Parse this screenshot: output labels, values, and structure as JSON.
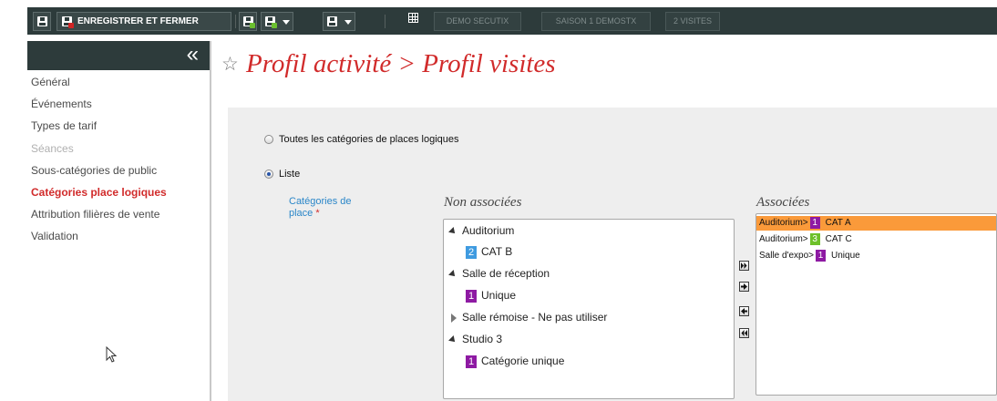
{
  "toolbar": {
    "save_and_close_label": "ENREGISTRER ET FERMER",
    "info_tags": [
      "DEMO SECUTIX",
      "SAISON 1 DEMOSTX",
      "2 VISITES"
    ]
  },
  "sidebar": {
    "items": [
      {
        "label": "Général",
        "state": "normal"
      },
      {
        "label": "Événements",
        "state": "normal"
      },
      {
        "label": "Types de tarif",
        "state": "normal"
      },
      {
        "label": "Séances",
        "state": "disabled"
      },
      {
        "label": "Sous-catégories de public",
        "state": "normal"
      },
      {
        "label": "Catégories place logiques",
        "state": "active"
      },
      {
        "label": "Attribution filières de vente",
        "state": "normal"
      },
      {
        "label": "Validation",
        "state": "normal"
      }
    ]
  },
  "page": {
    "title": "Profil activité > Profil visites"
  },
  "form": {
    "option_all_label": "Toutes les catégories de places logiques",
    "option_list_label": "Liste",
    "selected_option": "Liste",
    "categories_label": "Catégories de place",
    "required_marker": "*",
    "non_associated_heading": "Non associées",
    "associated_heading": "Associées",
    "non_associated": [
      {
        "group": "Auditorium",
        "expanded": true,
        "items": [
          {
            "badge": "2",
            "badge_color": "#3f9be0",
            "label": "CAT B"
          }
        ]
      },
      {
        "group": "Salle de réception",
        "expanded": true,
        "items": [
          {
            "badge": "1",
            "badge_color": "#8e1aa3",
            "label": "Unique"
          }
        ]
      },
      {
        "group": "Salle rémoise - Ne pas utiliser",
        "expanded": false,
        "items": []
      },
      {
        "group": "Studio 3",
        "expanded": true,
        "items": [
          {
            "badge": "1",
            "badge_color": "#8e1aa3",
            "label": "Catégorie unique"
          }
        ]
      }
    ],
    "associated": [
      {
        "prefix": "Auditorium>",
        "badge": "1",
        "badge_color": "#8e1aa3",
        "label": "CAT A",
        "selected": true
      },
      {
        "prefix": "Auditorium>",
        "badge": "3",
        "badge_color": "#6ec02a",
        "label": "CAT C",
        "selected": false
      },
      {
        "prefix": "Salle d'expo>",
        "badge": "1",
        "badge_color": "#8e1aa3",
        "label": "Unique",
        "selected": false
      }
    ],
    "transfer_buttons": [
      "move-all-right-icon",
      "move-right-icon",
      "move-left-icon",
      "move-all-left-icon"
    ]
  }
}
